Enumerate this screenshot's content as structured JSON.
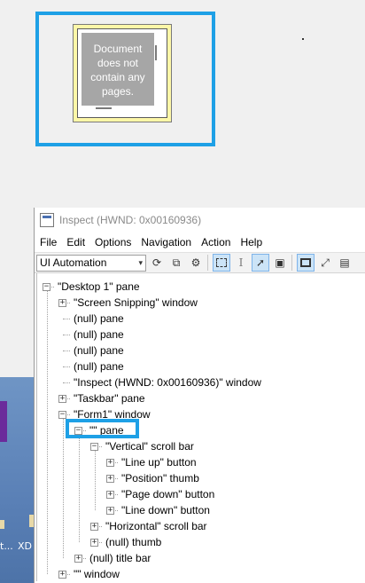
{
  "thumbnail": {
    "message": "Document does not contain any pages."
  },
  "inspect": {
    "title": "Inspect  (HWND: 0x00160936)",
    "menu": [
      "File",
      "Edit",
      "Options",
      "Navigation",
      "Action",
      "Help"
    ],
    "mode_combo": {
      "value": "UI Automation"
    },
    "toolbar_icons": [
      "refresh-icon",
      "copy-icon",
      "settings-icon",
      "watch-focus-icon",
      "caret-icon",
      "pointer-icon",
      "highlight-icon",
      "rectangle-icon",
      "expand-icon"
    ]
  },
  "tree": [
    {
      "label": "\"Desktop 1\" pane",
      "depth": 0,
      "expander": "minus"
    },
    {
      "label": "\"Screen Snipping\" window",
      "depth": 1,
      "expander": "plus"
    },
    {
      "label": "(null) pane",
      "depth": 1,
      "expander": "none"
    },
    {
      "label": "(null) pane",
      "depth": 1,
      "expander": "none"
    },
    {
      "label": "(null) pane",
      "depth": 1,
      "expander": "none"
    },
    {
      "label": "(null) pane",
      "depth": 1,
      "expander": "none"
    },
    {
      "label": "\"Inspect  (HWND: 0x00160936)\" window",
      "depth": 1,
      "expander": "none"
    },
    {
      "label": "\"Taskbar\" pane",
      "depth": 1,
      "expander": "plus"
    },
    {
      "label": "\"Form1\" window",
      "depth": 1,
      "expander": "minus"
    },
    {
      "label": "\"\" pane",
      "depth": 2,
      "expander": "minus"
    },
    {
      "label": "\"Vertical\" scroll bar",
      "depth": 3,
      "expander": "minus"
    },
    {
      "label": "\"Line up\" button",
      "depth": 4,
      "expander": "plus"
    },
    {
      "label": "\"Position\" thumb",
      "depth": 4,
      "expander": "plus"
    },
    {
      "label": "\"Page down\" button",
      "depth": 4,
      "expander": "plus"
    },
    {
      "label": "\"Line down\" button",
      "depth": 4,
      "expander": "plus"
    },
    {
      "label": "\"Horizontal\" scroll bar",
      "depth": 3,
      "expander": "plus"
    },
    {
      "label": "(null) thumb",
      "depth": 3,
      "expander": "plus"
    },
    {
      "label": "(null) title bar",
      "depth": 2,
      "expander": "plus"
    },
    {
      "label": "\"\" window",
      "depth": 1,
      "expander": "plus"
    }
  ],
  "desktop": {
    "label_left": "t...",
    "label_right": "XD"
  }
}
